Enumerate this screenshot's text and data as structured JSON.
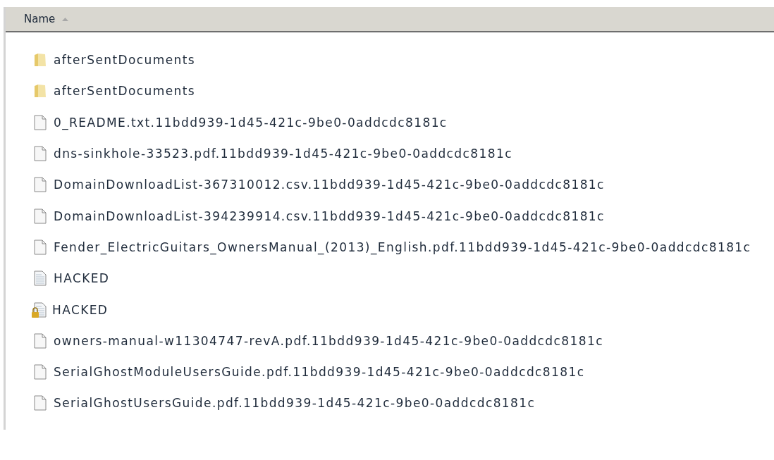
{
  "column_header": {
    "label": "Name",
    "sorted_ascending": true
  },
  "files": [
    {
      "name": "afterSentDocuments",
      "kind": "folder"
    },
    {
      "name": "afterSentDocuments",
      "kind": "folder"
    },
    {
      "name": "0_README.txt.11bdd939-1d45-421c-9be0-0addcdc8181c",
      "kind": "file"
    },
    {
      "name": "dns-sinkhole-33523.pdf.11bdd939-1d45-421c-9be0-0addcdc8181c",
      "kind": "file"
    },
    {
      "name": "DomainDownloadList-367310012.csv.11bdd939-1d45-421c-9be0-0addcdc8181c",
      "kind": "file"
    },
    {
      "name": "DomainDownloadList-394239914.csv.11bdd939-1d45-421c-9be0-0addcdc8181c",
      "kind": "file"
    },
    {
      "name": "Fender_ElectricGuitars_OwnersManual_(2013)_English.pdf.11bdd939-1d45-421c-9be0-0addcdc8181c",
      "kind": "file"
    },
    {
      "name": "HACKED",
      "kind": "text"
    },
    {
      "name": "HACKED",
      "kind": "locked-text"
    },
    {
      "name": "owners-manual-w11304747-revA.pdf.11bdd939-1d45-421c-9be0-0addcdc8181c",
      "kind": "file"
    },
    {
      "name": "SerialGhostModuleUsersGuide.pdf.11bdd939-1d45-421c-9be0-0addcdc8181c",
      "kind": "file"
    },
    {
      "name": "SerialGhostUsersGuide.pdf.11bdd939-1d45-421c-9be0-0addcdc8181c",
      "kind": "file"
    }
  ]
}
